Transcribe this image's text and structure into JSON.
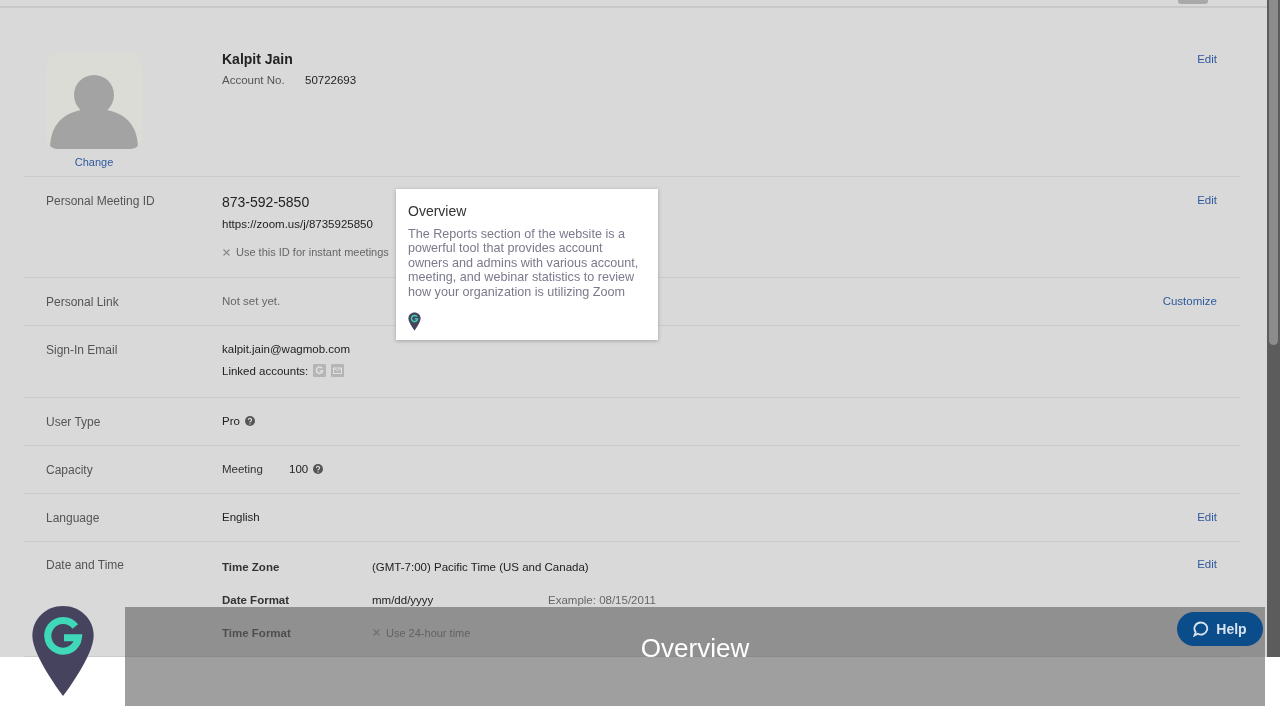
{
  "profile": {
    "name": "Kalpit Jain",
    "account_label": "Account No.",
    "account_number": "50722693",
    "change_link": "Change",
    "action": "Edit"
  },
  "rows": [
    {
      "kind": "meeting_id",
      "label": "Personal Meeting ID",
      "value": "873-592-5850",
      "link": "https://zoom.us/j/8735925850",
      "option": {
        "label": "Use this ID for instant meetings",
        "checked": false
      },
      "action": "Edit"
    },
    {
      "kind": "text",
      "label": "Personal Link",
      "value": "Not set yet.",
      "muted": true,
      "action": "Customize"
    },
    {
      "kind": "email",
      "label": "Sign-In Email",
      "value": "kalpit.jain@wagmob.com",
      "linked_label": "Linked accounts:"
    },
    {
      "kind": "user_type",
      "label": "User Type",
      "value": "Pro"
    },
    {
      "kind": "capacity",
      "label": "Capacity",
      "sub_label": "Meeting",
      "value": "100"
    },
    {
      "kind": "text",
      "label": "Language",
      "value": "English",
      "muted": false,
      "action": "Edit"
    },
    {
      "kind": "date_time",
      "label": "Date and Time",
      "action": "Edit",
      "entries": [
        {
          "label": "Time Zone",
          "value": "(GMT-7:00) Pacific Time (US and Canada)"
        },
        {
          "label": "Date Format",
          "value": "mm/dd/yyyy",
          "example": "Example: 08/15/2011"
        },
        {
          "label": "Time Format",
          "option": {
            "label": "Use 24-hour time",
            "checked": false
          }
        }
      ]
    }
  ],
  "tooltip": {
    "title": "Overview",
    "body": "The Reports section of the website is a powerful tool that provides account owners and admins with various account, meeting, and webinar statistics to review how your organization is utilizing Zoom"
  },
  "caption": "Overview",
  "help_button": "Help"
}
